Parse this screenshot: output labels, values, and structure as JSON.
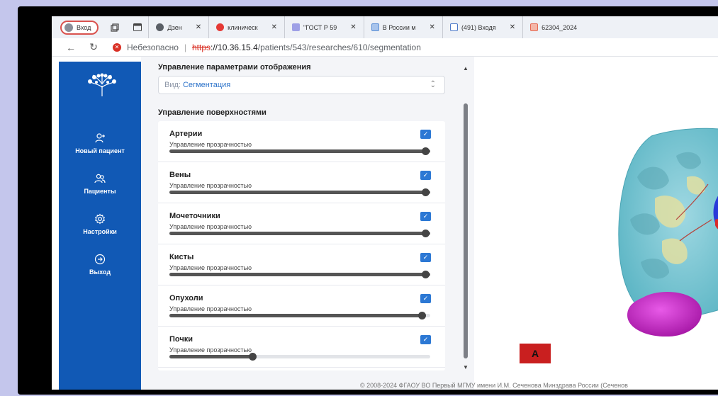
{
  "browser": {
    "profile_label": "Вход",
    "tabs": [
      {
        "title": "Дзен",
        "favicon_color": "#111111"
      },
      {
        "title": "клиническ",
        "favicon_color": "#e53935"
      },
      {
        "title": "\"ГОСТ Р 59",
        "favicon_color": "#7e7ad6"
      },
      {
        "title": "В России м",
        "favicon_color": "#5b8fd6"
      },
      {
        "title": "(491) Входя",
        "favicon_color": "#4a78c8"
      },
      {
        "title": "62304_2024",
        "favicon_color": "#e56a54"
      }
    ],
    "security_label": "Небезопасно",
    "url_scheme": "https",
    "url_host": "://10.36.15.4",
    "url_path": "/patients/543/researches/610/segmentation"
  },
  "sidebar": {
    "accent": "#1159b5",
    "items": [
      {
        "label": "Новый пациент",
        "icon": "add-user-icon"
      },
      {
        "label": "Пациенты",
        "icon": "users-icon"
      },
      {
        "label": "Настройки",
        "icon": "gear-icon"
      },
      {
        "label": "Выход",
        "icon": "logout-icon"
      }
    ]
  },
  "display": {
    "title": "Управление параметрами отображения",
    "view_prefix": "Вид:",
    "view_value": "Сегментация"
  },
  "surfaces": {
    "title": "Управление поверхностями",
    "items": [
      {
        "name": "Артерии",
        "sublabel": "Управление прозрачностью",
        "checked": true,
        "opacity": 1.0
      },
      {
        "name": "Вены",
        "sublabel": "Управление прозрачностью",
        "checked": true,
        "opacity": 1.0
      },
      {
        "name": "Мочеточники",
        "sublabel": "Управление прозрачностью",
        "checked": true,
        "opacity": 1.0
      },
      {
        "name": "Кисты",
        "sublabel": "Управление прозрачностью",
        "checked": true,
        "opacity": 1.0
      },
      {
        "name": "Опухоли",
        "sublabel": "Управление прозрачностью",
        "checked": true,
        "opacity": 0.97
      },
      {
        "name": "Почки",
        "sublabel": "Управление прозрачностью",
        "checked": true,
        "opacity": 0.32
      }
    ]
  },
  "viewer": {
    "marker_label": "A"
  },
  "footer": {
    "copyright": "© 2008-2024 ФГАОУ ВО Первый МГМУ имени И.М. Сеченова Минздрава России (Сеченов"
  }
}
